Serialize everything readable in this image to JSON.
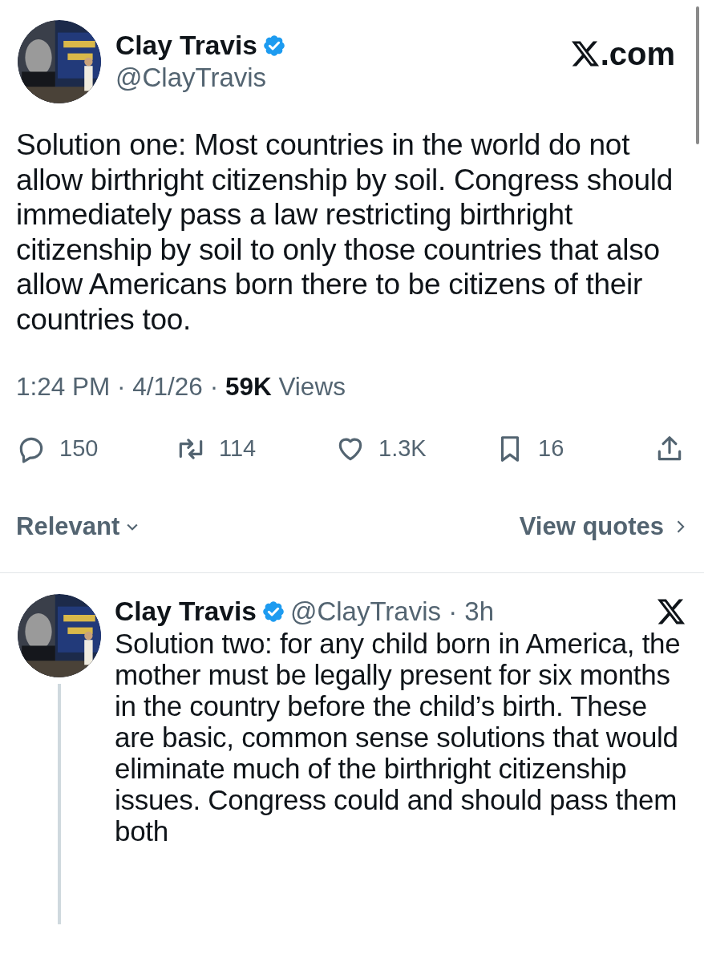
{
  "main_post": {
    "name": "Clay Travis",
    "verified": true,
    "handle": "@ClayTravis",
    "site": ".com",
    "text": "Solution one: Most countries in the world do not allow birthright citizenship by soil. Congress should immediately pass a law restricting birthright citizenship by soil to only those countries that also allow Americans born there to be citizens of their countries too.",
    "time": "1:24 PM · 4/1/26 · ",
    "views_count": "59K",
    "views_label": " Views",
    "actions": [
      {
        "kind": "reply",
        "count": "150"
      },
      {
        "kind": "repost",
        "count": "114"
      },
      {
        "kind": "like",
        "count": "1.3K"
      },
      {
        "kind": "bookmark",
        "count": "16"
      },
      {
        "kind": "share"
      }
    ]
  },
  "sort": {
    "label": "Relevant"
  },
  "quotes_link": "View quotes",
  "reply": {
    "name": "Clay Travis",
    "verified": true,
    "handle": "@ClayTravis · 3h",
    "text": "Solution two: for any child born in America, the mother must be legally present for six months in the country before the child’s birth. These are basic, common sense solutions that would eliminate much of the birthright citizenship issues. Congress could and should pass them both"
  }
}
